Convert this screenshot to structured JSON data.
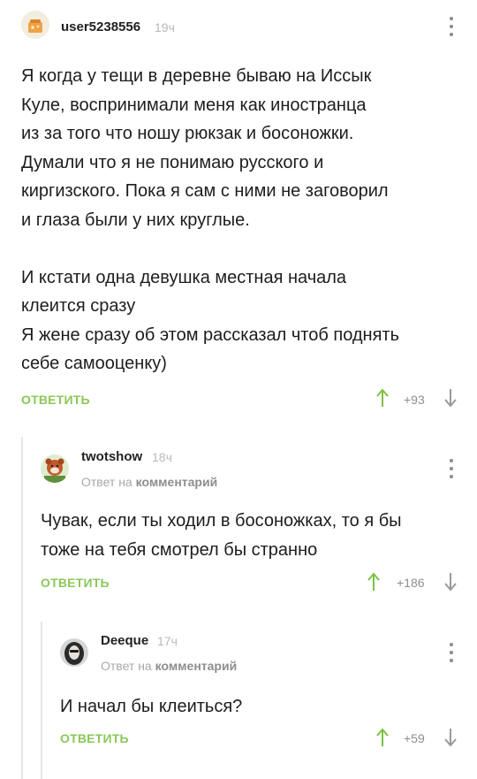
{
  "comments": [
    {
      "username": "user5238556",
      "time": "19ч",
      "avatar_icon": "cookie-jar-avatar",
      "text": "Я когда у тещи в деревне бываю на Иссык\nКуле, воспринимали меня как иностранца\nиз за того что ношу рюкзак и босоножки.\nДумали что я не понимаю русского и\nкиргизского. Пока я сам с ними не заговорил\nи глаза были у них круглые.\n\nИ кстати одна девушка местная начала\nклеится сразу\nЯ жене сразу об этом рассказал чтоб поднять\nсебе самооценку)",
      "reply_label": "ОТВЕТИТЬ",
      "votes": "+93"
    },
    {
      "username": "twotshow",
      "time": "18ч",
      "avatar_icon": "red-panda-avatar",
      "reply_to_prefix": "Ответ на",
      "reply_to_link": "комментарий",
      "text": "Чувак, если ты ходил в босоножках, то я бы\nтоже на тебя смотрел бы странно",
      "reply_label": "ОТВЕТИТЬ",
      "votes": "+186"
    },
    {
      "username": "Deeque",
      "time": "17ч",
      "avatar_icon": "portrait-avatar",
      "reply_to_prefix": "Ответ на",
      "reply_to_link": "комментарий",
      "text": "И начал бы клеиться?",
      "reply_label": "ОТВЕТИТЬ",
      "votes": "+59"
    }
  ],
  "colors": {
    "accent_green": "#8ac858",
    "thread_line": "#e6e6e6",
    "arrow_up": "#7cc143",
    "arrow_down": "#9a9a9a"
  }
}
